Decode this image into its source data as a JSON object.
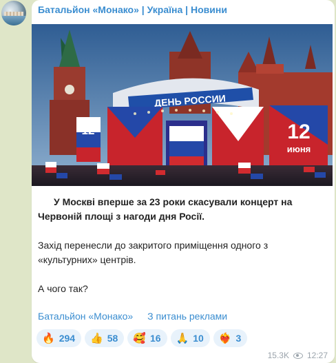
{
  "channel": {
    "name": "Батальйон «Монако» | Україна | Новини"
  },
  "photo": {
    "stage_banner": "ДЕНЬ РОССИИ",
    "screen_left_number": "12",
    "screen_right_number": "12",
    "screen_right_word": "июня"
  },
  "post": {
    "paragraphs": [
      "У Москві вперше за 23 роки скасували концерт на Червоній площі з нагоди дня Росії.",
      "Захід перенесли до закритого приміщення одного з «культурних» центрів.",
      "А чого так?"
    ],
    "links": [
      "Батальйон «Монако»",
      "З питань реклами"
    ]
  },
  "reactions": [
    {
      "icon": "fire-icon",
      "emoji": "🔥",
      "count": "294"
    },
    {
      "icon": "thumbs-up-icon",
      "emoji": "👍",
      "count": "58"
    },
    {
      "icon": "smiling-face-hearts-icon",
      "emoji": "🥰",
      "count": "16"
    },
    {
      "icon": "folded-hands-icon",
      "emoji": "🙏",
      "count": "10"
    },
    {
      "icon": "heart-on-fire-icon",
      "emoji": "❤️‍🔥",
      "count": "3"
    }
  ],
  "meta": {
    "views": "15.3K",
    "time": "12:27"
  }
}
